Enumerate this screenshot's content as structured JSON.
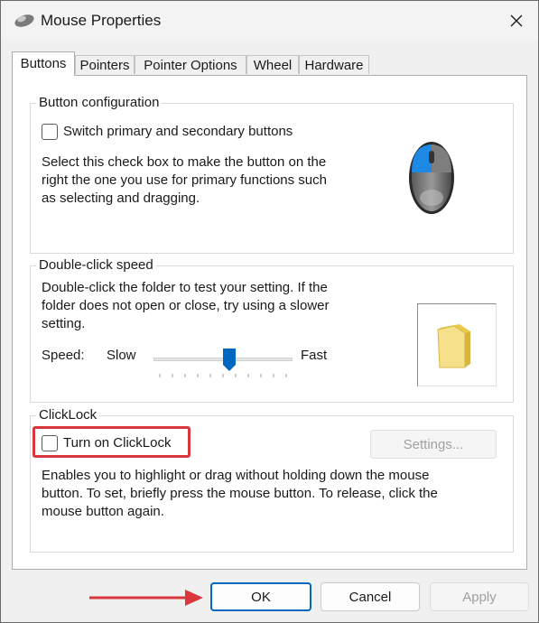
{
  "window": {
    "title": "Mouse Properties"
  },
  "tabs": [
    {
      "label": "Buttons",
      "active": true
    },
    {
      "label": "Pointers"
    },
    {
      "label": "Pointer Options"
    },
    {
      "label": "Wheel"
    },
    {
      "label": "Hardware"
    }
  ],
  "button_config": {
    "group_label": "Button configuration",
    "checkbox_label": "Switch primary and secondary buttons",
    "checked": false,
    "description_lines": [
      "Select this check box to make the button on the",
      "right the one you use for primary functions such",
      "as selecting and dragging."
    ]
  },
  "double_click": {
    "group_label": "Double-click speed",
    "description_lines": [
      "Double-click the folder to test your setting. If the",
      "folder does not open or close, try using a slower",
      "setting."
    ],
    "speed_label": "Speed:",
    "slow_label": "Slow",
    "fast_label": "Fast",
    "slider_value": 0.55
  },
  "clicklock": {
    "group_label": "ClickLock",
    "checkbox_label": "Turn on ClickLock",
    "checked": false,
    "settings_label": "Settings...",
    "description_lines": [
      "Enables you to highlight or drag without holding down the mouse",
      "button. To set, briefly press the mouse button. To release, click the",
      "mouse button again."
    ]
  },
  "footer": {
    "ok_label": "OK",
    "cancel_label": "Cancel",
    "apply_label": "Apply"
  },
  "colors": {
    "highlight_red": "#d9363e",
    "accent_blue": "#0067c0"
  }
}
